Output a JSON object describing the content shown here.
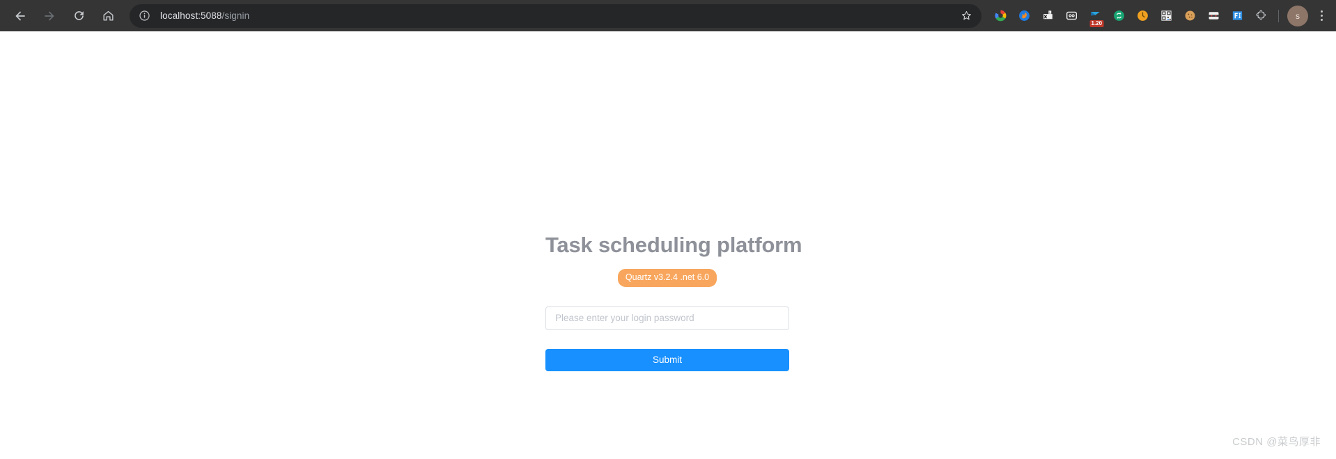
{
  "browser": {
    "nav": {
      "back_label": "Back",
      "forward_label": "Forward",
      "reload_label": "Reload",
      "home_label": "Home"
    },
    "address_bar": {
      "site_info_label": "View site information",
      "url_host": "localhost:5088",
      "url_path": "/signin",
      "url_full": "localhost:5088/signin",
      "bookmark_label": "Bookmark this tab"
    },
    "extensions": [
      {
        "name": "google-extension",
        "label": "Google",
        "badge": ""
      },
      {
        "name": "firefox-extension",
        "label": "Firefox Relay",
        "badge": ""
      },
      {
        "name": "fax-print-extension",
        "label": "Print / Export",
        "badge": ""
      },
      {
        "name": "voice-recorder-extension",
        "label": "Voice Recorder",
        "badge": ""
      },
      {
        "name": "download-extension",
        "label": "Downloader",
        "badge": "1.20"
      },
      {
        "name": "sync-extension",
        "label": "Sync",
        "badge": ""
      },
      {
        "name": "clock-extension",
        "label": "Clock",
        "badge": ""
      },
      {
        "name": "qr-code-extension",
        "label": "QR Code",
        "badge": ""
      },
      {
        "name": "cookie-extension",
        "label": "Cookie Editor",
        "badge": ""
      },
      {
        "name": "incognito-extension",
        "label": "Incognito Proxy",
        "badge": ""
      },
      {
        "name": "fi-extension",
        "label": "FI Tool",
        "badge": ""
      },
      {
        "name": "puzzle-extensions",
        "label": "Extensions",
        "badge": ""
      }
    ],
    "profile": {
      "avatar_initial": "s",
      "avatar_label": "Profile"
    },
    "menu_label": "Customize and control Google Chrome"
  },
  "page": {
    "title": "Task scheduling platform",
    "version_badge": "Quartz v3.2.4 .net 6.0",
    "password": {
      "value": "",
      "placeholder": "Please enter your login password"
    },
    "submit_label": "Submit",
    "watermark": "CSDN @菜鸟厚非"
  },
  "colors": {
    "toolbar_bg": "#353535",
    "url_pill_bg": "#252628",
    "accent_blue": "#1890ff",
    "badge_orange": "#f8a65d",
    "title_gray": "#8e9199",
    "badge_red": "#c0392b"
  }
}
